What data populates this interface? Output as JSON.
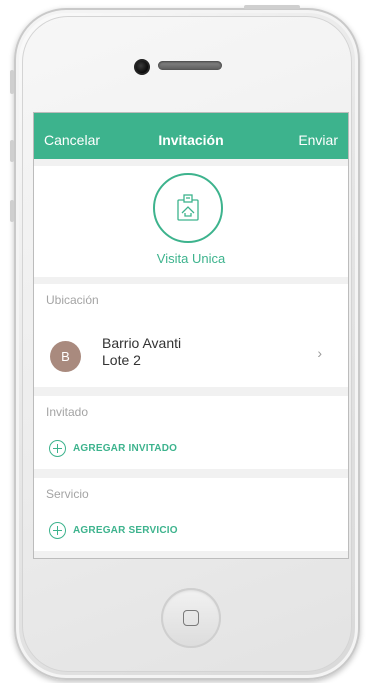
{
  "navbar": {
    "cancel_label": "Cancelar",
    "title": "Invitación",
    "send_label": "Enviar"
  },
  "visit_type": {
    "label": "Visita Unica",
    "icon": "calendar-icon"
  },
  "location": {
    "section_label": "Ubicación",
    "avatar_initial": "B",
    "name": "Barrio Avanti",
    "sublabel": "Lote 2",
    "chevron": "›"
  },
  "guest": {
    "section_label": "Invitado",
    "add_label": "AGREGAR INVITADO"
  },
  "service": {
    "section_label": "Servicio",
    "add_label": "AGREGAR SERVICIO"
  },
  "colors": {
    "accent": "#3db38d",
    "avatar": "#a98a7e",
    "muted": "#a4a4a4"
  }
}
